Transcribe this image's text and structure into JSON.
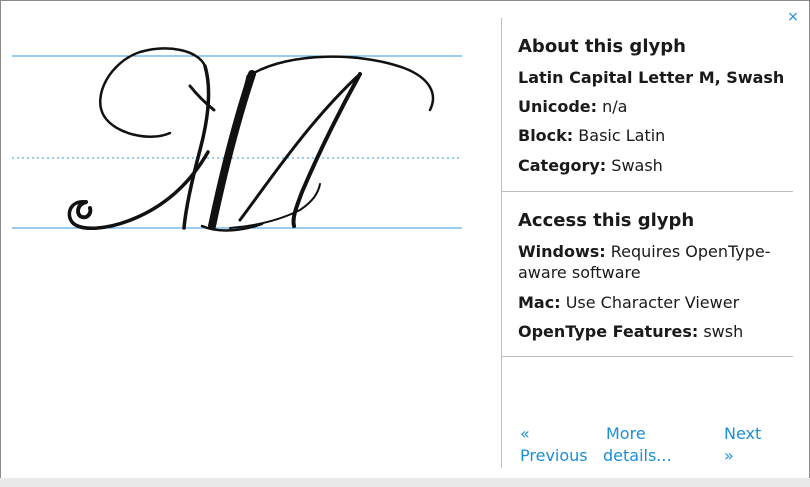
{
  "close": {
    "glyph": "×"
  },
  "glyph": {
    "char": "M"
  },
  "about": {
    "title": "About this glyph",
    "name": "Latin Capital Letter M, Swash",
    "unicode_label": "Unicode:",
    "unicode_value": "n/a",
    "block_label": "Block:",
    "block_value": "Basic Latin",
    "category_label": "Category:",
    "category_value": "Swash"
  },
  "access": {
    "title": "Access this glyph",
    "windows_label": "Windows:",
    "windows_value_1": "Requires OpenType-",
    "windows_value_2": "aware software",
    "mac_label": "Mac:",
    "mac_value": "Use Character Viewer",
    "features_label": "OpenType Features:",
    "features_value": "swsh"
  },
  "nav": {
    "previous_line1": "«",
    "previous_line2": "Previous",
    "more_line1": "More",
    "more_line2": "details...",
    "next_line1": "Next",
    "next_line2": "»"
  },
  "colors": {
    "accent": "#1a8fd8",
    "guide_line": "#3a9ad9",
    "text": "#1a1a1a",
    "divider": "#bdbdbd"
  }
}
